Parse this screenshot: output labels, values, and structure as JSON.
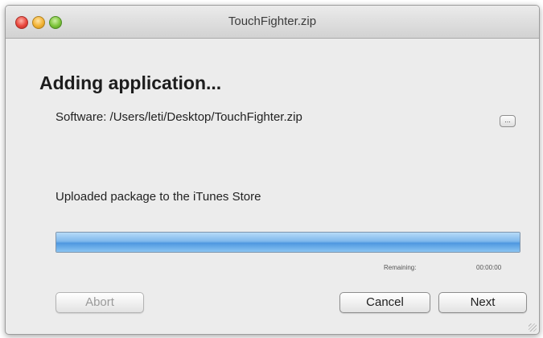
{
  "window": {
    "title": "TouchFighter.zip"
  },
  "dialog": {
    "heading": "Adding application...",
    "software_text": "Software: /Users/leti/Desktop/TouchFighter.zip",
    "browse_label": "...",
    "status_text": "Uploaded package to the iTunes Store",
    "progress_fraction": 1.0,
    "remaining_label": "Remaining:",
    "remaining_value": "00:00:00"
  },
  "buttons": {
    "abort": "Abort",
    "cancel": "Cancel",
    "next": "Next"
  },
  "colors": {
    "progress_blue": "#6aa8e6",
    "window_bg": "#ececec"
  }
}
